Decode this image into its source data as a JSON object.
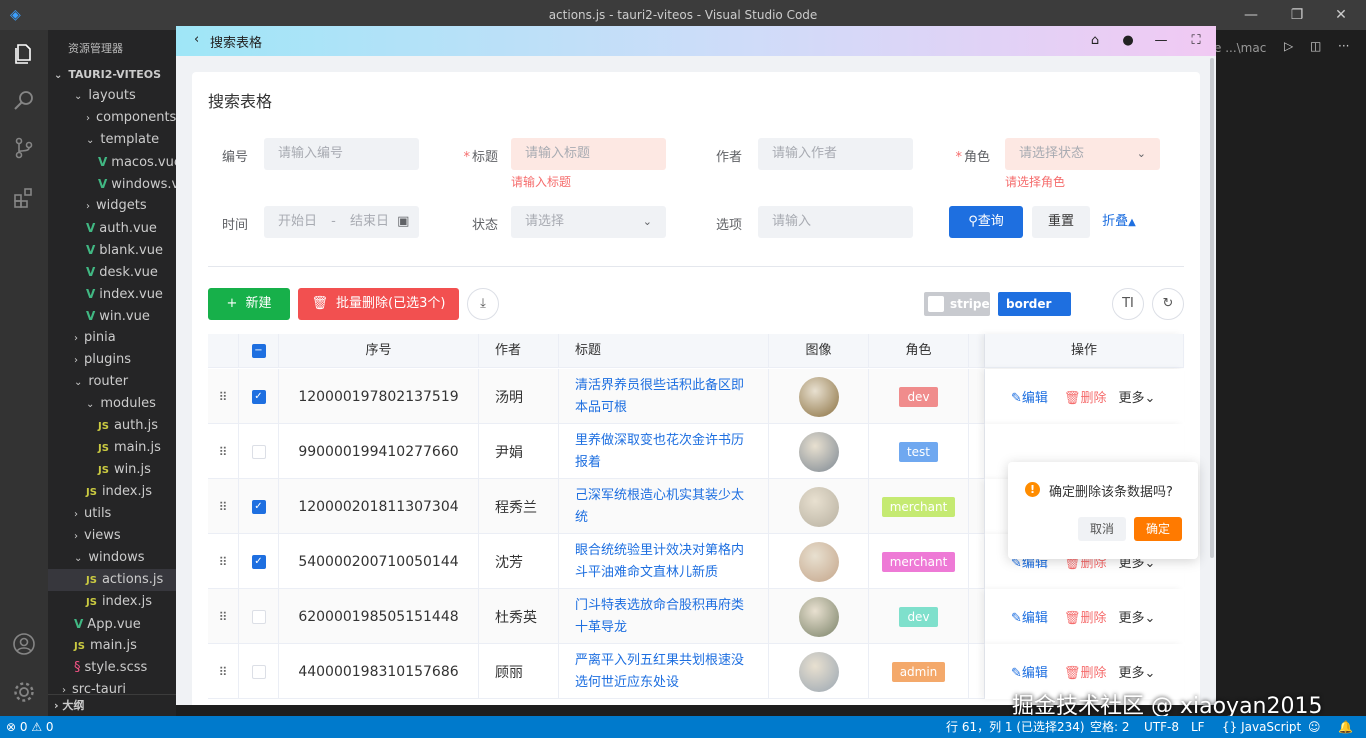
{
  "window": {
    "title": "actions.js - tauri2-viteos - Visual Studio Code"
  },
  "explorer": {
    "header": "资源管理器",
    "project": "TAURI2-VITEOS",
    "items": [
      {
        "label": "layouts",
        "kind": "folder",
        "open": true,
        "indent": 1
      },
      {
        "label": "components",
        "kind": "folder",
        "open": false,
        "indent": 2
      },
      {
        "label": "template",
        "kind": "folder",
        "open": true,
        "indent": 2
      },
      {
        "label": "macos.vue",
        "kind": "vue",
        "indent": 3
      },
      {
        "label": "windows.vue",
        "kind": "vue",
        "indent": 3
      },
      {
        "label": "widgets",
        "kind": "folder",
        "open": false,
        "indent": 2
      },
      {
        "label": "auth.vue",
        "kind": "vue",
        "indent": 2
      },
      {
        "label": "blank.vue",
        "kind": "vue",
        "indent": 2
      },
      {
        "label": "desk.vue",
        "kind": "vue",
        "indent": 2
      },
      {
        "label": "index.vue",
        "kind": "vue",
        "indent": 2
      },
      {
        "label": "win.vue",
        "kind": "vue",
        "indent": 2
      },
      {
        "label": "pinia",
        "kind": "folder",
        "open": false,
        "indent": 1
      },
      {
        "label": "plugins",
        "kind": "folder",
        "open": false,
        "indent": 1
      },
      {
        "label": "router",
        "kind": "folder",
        "open": true,
        "indent": 1
      },
      {
        "label": "modules",
        "kind": "folder",
        "open": true,
        "indent": 2
      },
      {
        "label": "auth.js",
        "kind": "js",
        "indent": 3
      },
      {
        "label": "main.js",
        "kind": "js",
        "indent": 3
      },
      {
        "label": "win.js",
        "kind": "js",
        "indent": 3
      },
      {
        "label": "index.js",
        "kind": "js",
        "indent": 2
      },
      {
        "label": "utils",
        "kind": "folder",
        "open": false,
        "indent": 1
      },
      {
        "label": "views",
        "kind": "folder",
        "open": false,
        "indent": 1
      },
      {
        "label": "windows",
        "kind": "folder",
        "open": true,
        "indent": 1
      },
      {
        "label": "actions.js",
        "kind": "js",
        "indent": 2,
        "selected": true
      },
      {
        "label": "index.js",
        "kind": "js",
        "indent": 2
      },
      {
        "label": "App.vue",
        "kind": "vue",
        "indent": 1
      },
      {
        "label": "main.js",
        "kind": "js",
        "indent": 1
      },
      {
        "label": "style.scss",
        "kind": "scss",
        "indent": 1
      },
      {
        "label": "src-tauri",
        "kind": "folder",
        "open": false,
        "indent": 0
      }
    ],
    "outline": "大纲"
  },
  "tabstrip": {
    "text": "e ...\\mac"
  },
  "statusbar": {
    "problems": "⊗ 0 ⚠ 0",
    "position": "行 61，列 1 (已选择234)",
    "spaces": "空格: 2",
    "encoding": "UTF-8",
    "eol": "LF",
    "language": "{} JavaScript"
  },
  "watermark": "掘金技术社区 @ xiaoyan2015",
  "app": {
    "title": "搜索表格",
    "card_title": "搜索表格",
    "form": {
      "no_label": "编号",
      "no_placeholder": "请输入编号",
      "title_label": "标题",
      "title_placeholder": "请输入标题",
      "title_error": "请输入标题",
      "author_label": "作者",
      "author_placeholder": "请输入作者",
      "role_label": "角色",
      "role_placeholder": "请选择状态",
      "role_error": "请选择角色",
      "time_label": "时间",
      "time_start": "开始日",
      "time_sep": "-",
      "time_end": "结束日",
      "status_label": "状态",
      "status_placeholder": "请选择",
      "option_label": "选项",
      "option_placeholder": "请输入",
      "search_btn": "查询",
      "reset_btn": "重置",
      "collapse_btn": "折叠"
    },
    "toolbar": {
      "new_btn": "新建",
      "batch_delete_btn": "批量删除(已选3个)",
      "stripe_label": "stripe",
      "border_label": "border"
    },
    "table": {
      "headers": {
        "seq": "序号",
        "author": "作者",
        "title": "标题",
        "image": "图像",
        "role": "角色",
        "ops": "操作"
      },
      "ops": {
        "edit": "编辑",
        "delete": "删除",
        "more": "更多"
      },
      "rows": [
        {
          "checked": true,
          "seq": "120000197802137519",
          "author": "汤明",
          "title": "清活界养员很些话积此备区即本品可根",
          "role": "dev",
          "role_color": "#f08c8c",
          "avatar": "#8a7040",
          "ops_visible": true
        },
        {
          "checked": false,
          "seq": "990000199410277660",
          "author": "尹娟",
          "title": "里养做深取变也花次金许书历报着",
          "role": "test",
          "role_color": "#6fa8f0",
          "avatar": "#7d8893",
          "ops_visible": false
        },
        {
          "checked": true,
          "seq": "120000201811307304",
          "author": "程秀兰",
          "title": "己深军统根造心机实其装少太统",
          "role": "merchant",
          "role_color": "#c5ea72",
          "avatar": "#b7b0a0",
          "ops_visible": false
        },
        {
          "checked": true,
          "seq": "540000200710050144",
          "author": "沈芳",
          "title": "眼合统统验里计效决对第格内斗平油难命文直林儿新质",
          "role": "merchant",
          "role_color": "#ee7ad6",
          "avatar": "#c4a58a",
          "ops_visible": true
        },
        {
          "checked": false,
          "seq": "620000198505151448",
          "author": "杜秀英",
          "title": "门斗特表选放命合股积再府类十革导龙",
          "role": "dev",
          "role_color": "#7fe0cc",
          "avatar": "#7a8268",
          "ops_visible": true
        },
        {
          "checked": false,
          "seq": "440000198310157686",
          "author": "顾丽",
          "title": "严离平入列五红果共划根速没选何世近应东处设",
          "role": "admin",
          "role_color": "#f4a96b",
          "avatar": "#9aa6b2",
          "ops_visible": true
        }
      ]
    },
    "popconfirm": {
      "message": "确定删除该条数据吗?",
      "cancel": "取消",
      "confirm": "确定"
    }
  }
}
